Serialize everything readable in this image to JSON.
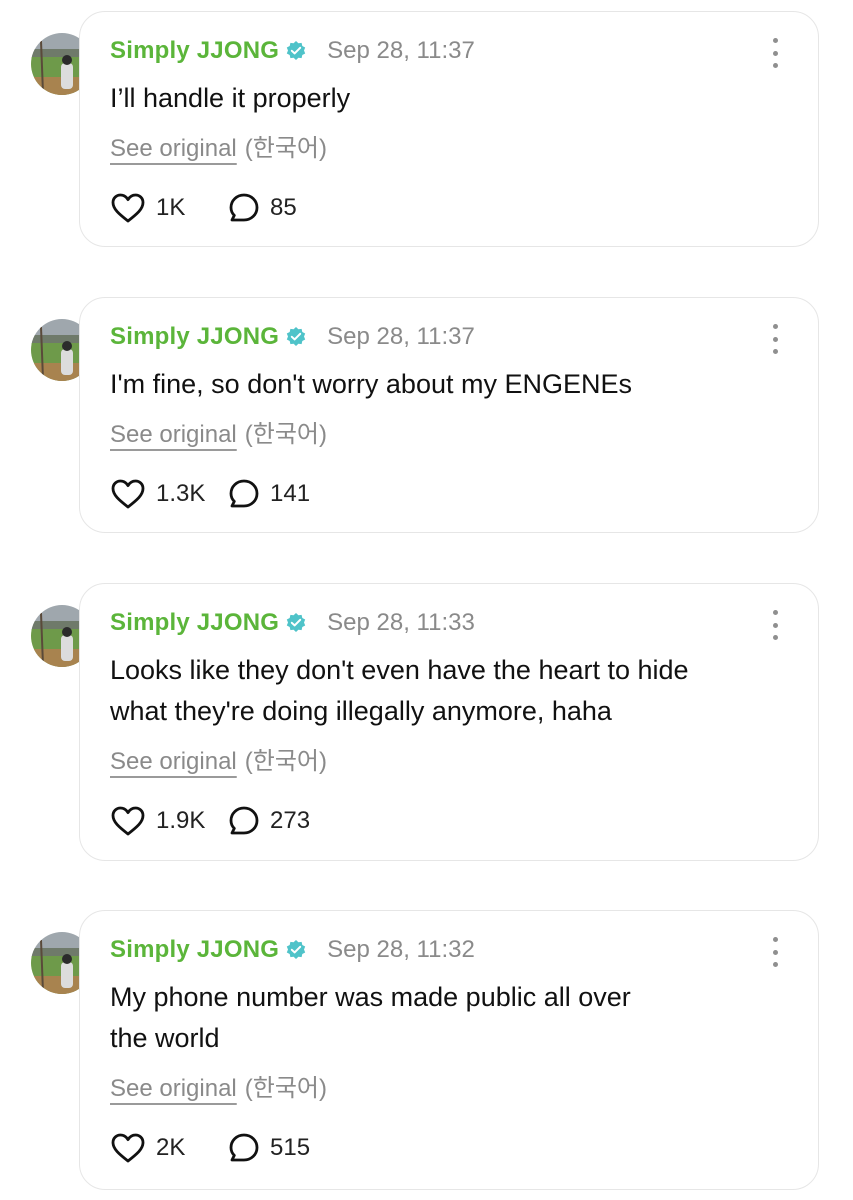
{
  "posts": [
    {
      "author": "Simply JJONG",
      "time": "Sep 28, 11:37",
      "text": "I’ll handle it properly",
      "see_original": "See original",
      "lang": "(한국어)",
      "likes": "1K",
      "replies": "85"
    },
    {
      "author": "Simply JJONG",
      "time": "Sep 28, 11:37",
      "text": "I'm fine, so don't worry about my ENGENEs",
      "see_original": "See original",
      "lang": "(한국어)",
      "likes": "1.3K",
      "replies": "141"
    },
    {
      "author": "Simply JJONG",
      "time": "Sep 28, 11:33",
      "text": "Looks like they don't even have the heart to hide\nwhat they're doing illegally anymore, haha",
      "see_original": "See original",
      "lang": "(한국어)",
      "likes": "1.9K",
      "replies": "273"
    },
    {
      "author": "Simply JJONG",
      "time": "Sep 28, 11:32",
      "text": "My phone number was made public all over\nthe world",
      "see_original": "See original",
      "lang": "(한국어)",
      "likes": "2K",
      "replies": "515"
    }
  ],
  "colors": {
    "author": "#5bb53a",
    "verified": "#4fc3c9",
    "muted": "#8a8a8a",
    "border": "#e6e6e6"
  },
  "icons": {
    "verified": "verified-badge-icon",
    "like": "heart-icon",
    "reply": "speech-bubble-icon",
    "more": "more-vertical-icon"
  }
}
